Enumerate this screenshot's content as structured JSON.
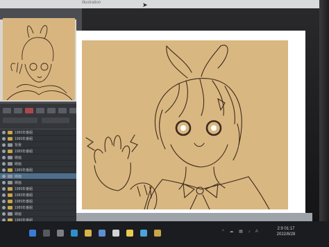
{
  "window": {
    "title": "illustration"
  },
  "layers": [
    {
      "name": "1989年番組",
      "type": "folder",
      "selected": false
    },
    {
      "name": "1989年番組",
      "type": "folder",
      "selected": false
    },
    {
      "name": "背景",
      "type": "layer",
      "selected": false
    },
    {
      "name": "1989年番組",
      "type": "folder",
      "selected": false
    },
    {
      "name": "線画",
      "type": "layer",
      "selected": false
    },
    {
      "name": "線画",
      "type": "layer",
      "selected": false
    },
    {
      "name": "1989年番組",
      "type": "folder",
      "selected": false
    },
    {
      "name": "線画",
      "type": "layer",
      "selected": true
    },
    {
      "name": "線画",
      "type": "layer",
      "selected": false
    },
    {
      "name": "1989年番組",
      "type": "folder",
      "selected": false
    },
    {
      "name": "1989年番組",
      "type": "folder",
      "selected": false
    },
    {
      "name": "1989年番組",
      "type": "folder",
      "selected": false
    },
    {
      "name": "1989年番組",
      "type": "folder",
      "selected": false
    },
    {
      "name": "線画",
      "type": "layer",
      "selected": false
    },
    {
      "name": "1989年番組",
      "type": "folder",
      "selected": false
    },
    {
      "name": "1989年番組",
      "type": "folder",
      "selected": false
    }
  ],
  "taskbar": {
    "clock_time": "2:9 01:17",
    "clock_date": "2022/8/28",
    "tray": "^ ☁ ▦ ♪ A"
  },
  "colors": {
    "canvas_fill": "#d9b780",
    "line_art": "#3b2a1f",
    "selected_layer": "#4d6f8e"
  },
  "icons": [
    "start-icon",
    "search-icon",
    "taskview-icon",
    "edge-icon",
    "explorer-icon",
    "store-icon",
    "mail-icon",
    "clip-studio-icon",
    "chrome-icon",
    "app-icon"
  ]
}
